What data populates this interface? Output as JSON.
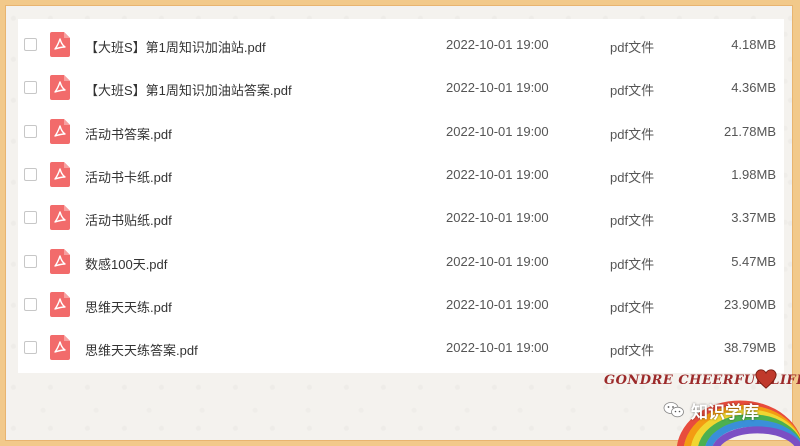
{
  "files": [
    {
      "name": "【大班S】第1周知识加油站.pdf",
      "date": "2022-10-01 19:00",
      "type": "pdf文件",
      "size": "4.18MB"
    },
    {
      "name": "【大班S】第1周知识加油站答案.pdf",
      "date": "2022-10-01 19:00",
      "type": "pdf文件",
      "size": "4.36MB"
    },
    {
      "name": "活动书答案.pdf",
      "date": "2022-10-01 19:00",
      "type": "pdf文件",
      "size": "21.78MB"
    },
    {
      "name": "活动书卡纸.pdf",
      "date": "2022-10-01 19:00",
      "type": "pdf文件",
      "size": "1.98MB"
    },
    {
      "name": "活动书贴纸.pdf",
      "date": "2022-10-01 19:00",
      "type": "pdf文件",
      "size": "3.37MB"
    },
    {
      "name": "数感100天.pdf",
      "date": "2022-10-01 19:00",
      "type": "pdf文件",
      "size": "5.47MB"
    },
    {
      "name": "思维天天练.pdf",
      "date": "2022-10-01 19:00",
      "type": "pdf文件",
      "size": "23.90MB"
    },
    {
      "name": "思维天天练答案.pdf",
      "date": "2022-10-01 19:00",
      "type": "pdf文件",
      "size": "38.79MB"
    }
  ],
  "branding": {
    "text": "GONDRE CHEERFUL LIFE",
    "icon": "heart-icon"
  },
  "watermark": {
    "text": "知识学库",
    "icon": "wechat-icon"
  },
  "colors": {
    "pdf_icon": "#f26b6b",
    "frame": "#f2c98a",
    "brand_text": "#9c2a2a",
    "heart": "#c0392b"
  }
}
